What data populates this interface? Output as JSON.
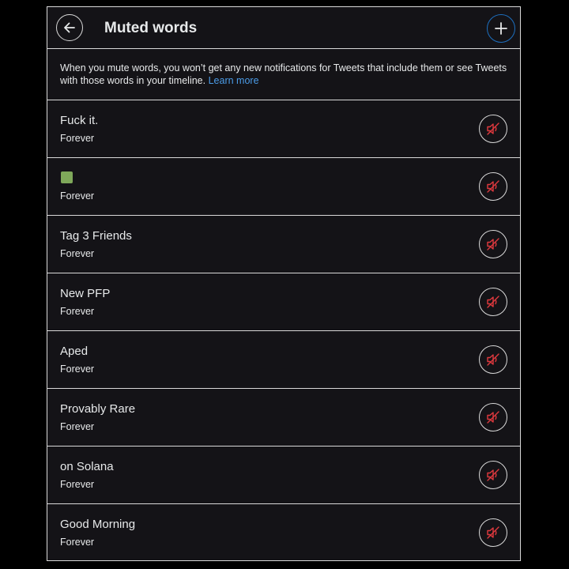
{
  "header": {
    "title": "Muted words",
    "back_icon": "arrow-left-icon",
    "add_icon": "plus-icon"
  },
  "description": {
    "text": "When you mute words, you won’t get any new notifications for Tweets that include them or see Tweets with those words in your timeline. ",
    "link": "Learn more"
  },
  "muted_words": [
    {
      "word": "Fuck it.",
      "duration": "Forever"
    },
    {
      "word": "",
      "emoji": "green-square",
      "duration": "Forever"
    },
    {
      "word": "Tag 3 Friends",
      "duration": "Forever"
    },
    {
      "word": "New PFP",
      "duration": "Forever"
    },
    {
      "word": "Aped",
      "duration": "Forever"
    },
    {
      "word": "Provably Rare",
      "duration": "Forever"
    },
    {
      "word": "on Solana",
      "duration": "Forever"
    },
    {
      "word": "Good Morning",
      "duration": "Forever"
    }
  ],
  "unmute_icon": "speaker-muted-icon",
  "colors": {
    "background": "#141317",
    "border": "#d9d9d9",
    "text": "#e7e9ea",
    "link": "#4b9ce8",
    "accent_border": "#1d6fbf",
    "unmute_icon": "#e0393e",
    "emoji_green": "#7fa85a"
  }
}
